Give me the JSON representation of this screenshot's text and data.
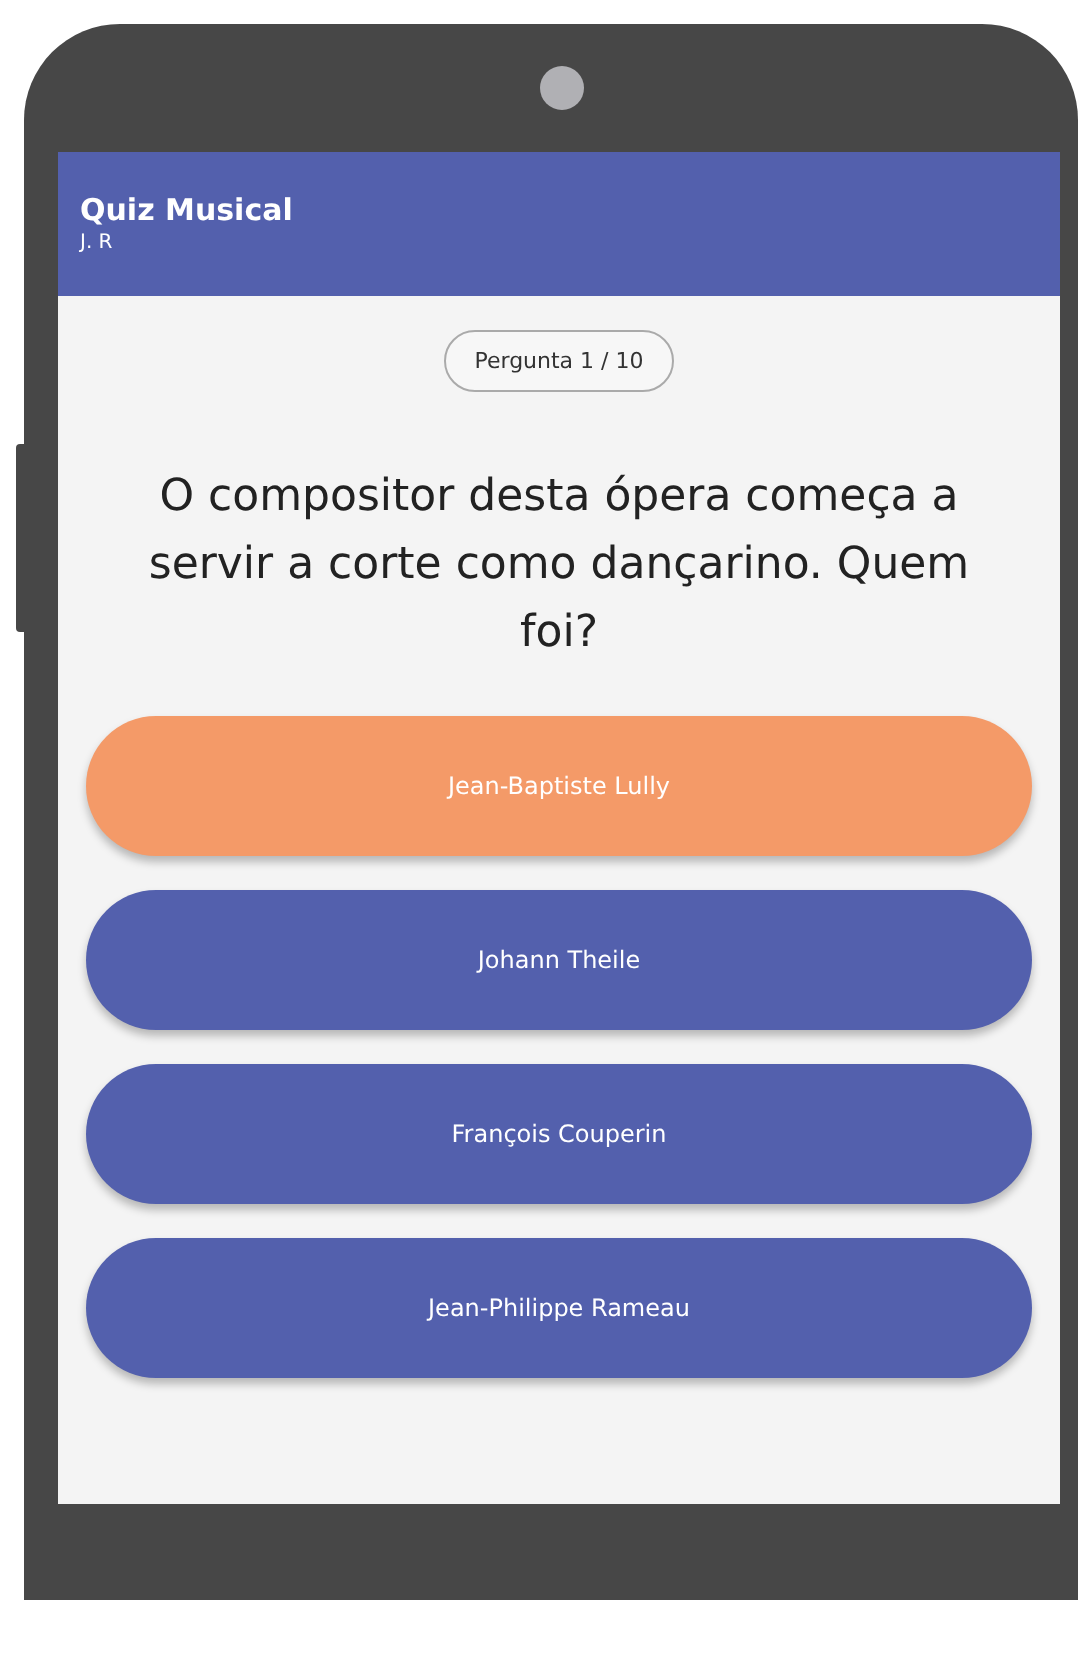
{
  "app_bar": {
    "title": "Quiz Musical",
    "subtitle": "J. R"
  },
  "progress": "Pergunta 1 / 10",
  "question": "O compositor desta ópera começa a servir a corte como dançarino. Quem foi?",
  "answers": [
    {
      "label": "Jean-Baptiste Lully",
      "selected": true
    },
    {
      "label": "Johann Theile",
      "selected": false
    },
    {
      "label": "François Couperin",
      "selected": false
    },
    {
      "label": "Jean-Philippe Rameau",
      "selected": false
    }
  ]
}
